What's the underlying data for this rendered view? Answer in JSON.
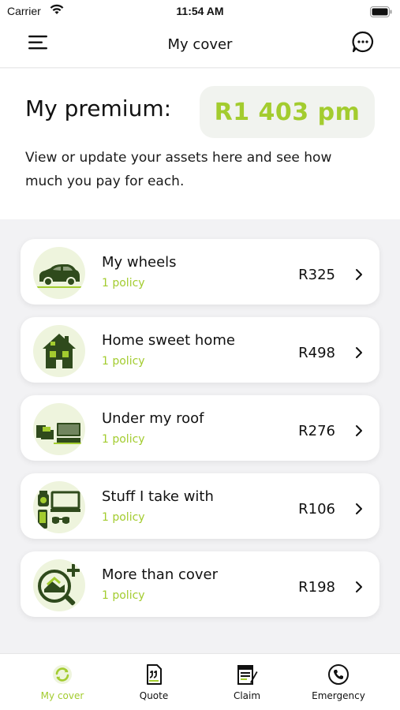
{
  "status": {
    "carrier": "Carrier",
    "time": "11:54 AM"
  },
  "header": {
    "title": "My cover",
    "menu_icon": "hamburger-icon",
    "chat_icon": "chat-bubble-icon"
  },
  "premium": {
    "label": "My premium:",
    "amount": "R1 403 pm",
    "description": "View or update your assets here and see how much you pay for each."
  },
  "assets": [
    {
      "name": "My wheels",
      "sub": "1 policy",
      "price": "R325",
      "icon": "car-icon"
    },
    {
      "name": "Home sweet home",
      "sub": "1 policy",
      "price": "R498",
      "icon": "house-icon"
    },
    {
      "name": "Under my roof",
      "sub": "1 policy",
      "price": "R276",
      "icon": "furniture-icon"
    },
    {
      "name": "Stuff I take with",
      "sub": "1 policy",
      "price": "R106",
      "icon": "gadgets-icon"
    },
    {
      "name": "More than cover",
      "sub": "1 policy",
      "price": "R198",
      "icon": "magnifier-plus-icon"
    }
  ],
  "tabs": [
    {
      "label": "My cover",
      "icon": "refresh-circle-icon",
      "active": true
    },
    {
      "label": "Quote",
      "icon": "quote-document-icon",
      "active": false
    },
    {
      "label": "Claim",
      "icon": "claim-form-icon",
      "active": false
    },
    {
      "label": "Emergency",
      "icon": "phone-circle-icon",
      "active": false
    }
  ],
  "colors": {
    "accent": "#a3cc2f",
    "icon_dark": "#2f4a1c",
    "icon_bg": "#eef4dd",
    "premium_pill_bg": "#f1f3ef"
  }
}
